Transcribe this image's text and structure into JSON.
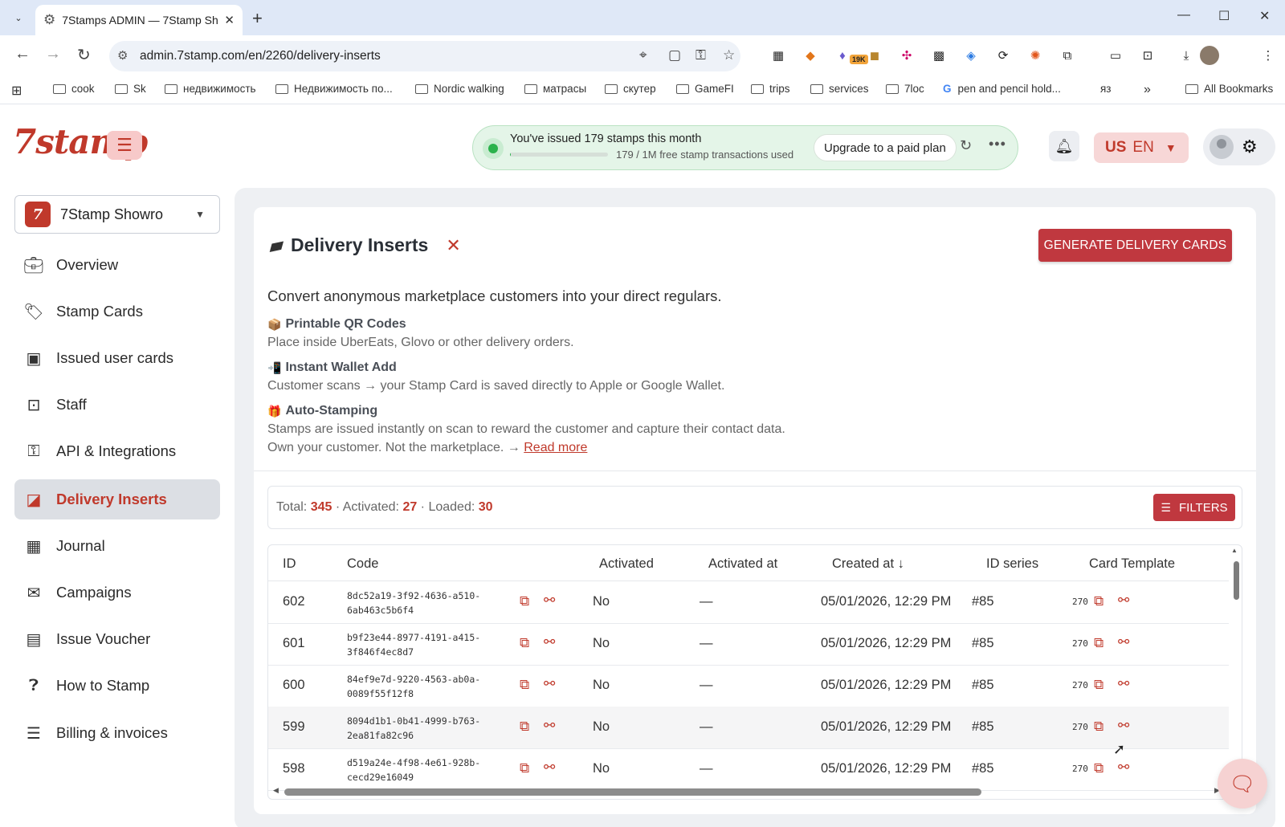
{
  "browser": {
    "tab_title": "7Stamps ADMIN — 7Stamp Sh",
    "url": "admin.7stamp.com/en/2260/delivery-inserts",
    "ext_badge": "19K",
    "bookmarks": [
      "cook",
      "Sk",
      "недвижимость",
      "Недвижимость по...",
      "Nordic walking",
      "матрасы",
      "скутер",
      "GameFI",
      "trips",
      "services",
      "7loc",
      "pen and pencil hold...",
      "яз"
    ],
    "all_bookmarks": "All Bookmarks"
  },
  "header": {
    "logo": "7stamp",
    "usage_title": "You've issued 179 stamps this month",
    "usage_sub": "179 / 1M free stamp transactions used",
    "usage_fraction": 0.000179,
    "upgrade_label": "Upgrade to a paid plan",
    "lang_flag": "US",
    "lang_code": "EN"
  },
  "sidebar": {
    "org_name": "7Stamp Showro",
    "items": [
      {
        "label": "Overview",
        "icon": "briefcase-icon"
      },
      {
        "label": "Stamp Cards",
        "icon": "tag-icon"
      },
      {
        "label": "Issued user cards",
        "icon": "id-card-icon"
      },
      {
        "label": "Staff",
        "icon": "badge-icon"
      },
      {
        "label": "API & Integrations",
        "icon": "key-icon"
      },
      {
        "label": "Delivery Inserts",
        "icon": "inserts-icon",
        "active": true
      },
      {
        "label": "Journal",
        "icon": "table-icon"
      },
      {
        "label": "Campaigns",
        "icon": "mail-icon"
      },
      {
        "label": "Issue Voucher",
        "icon": "voucher-icon"
      },
      {
        "label": "How to Stamp",
        "icon": "help-icon"
      },
      {
        "label": "Billing & invoices",
        "icon": "list-icon"
      }
    ]
  },
  "page": {
    "title": "Delivery Inserts",
    "generate_label": "GENERATE DELIVERY CARDS",
    "lead": "Convert anonymous marketplace customers into your direct regulars.",
    "features": [
      {
        "title": "Printable QR Codes",
        "text": "Place inside UberEats, Glovo or other delivery orders."
      },
      {
        "title": "Instant Wallet Add",
        "text": "Customer scans → your Stamp Card is saved directly to Apple or Google Wallet."
      },
      {
        "title": "Auto-Stamping",
        "text": "Stamps are issued instantly on scan to reward the customer and capture their contact data."
      }
    ],
    "closing_text": "Own your customer. Not the marketplace. → ",
    "read_more": "Read more",
    "stats": {
      "total_label": "Total: ",
      "total": "345",
      "activated_label": " · Activated: ",
      "activated": "27",
      "loaded_label": " · Loaded: ",
      "loaded": "30"
    },
    "filters_label": "FILTERS"
  },
  "table": {
    "columns": [
      "ID",
      "Code",
      "Activated",
      "Activated at",
      "Created at",
      "ID series",
      "Card Template"
    ],
    "sort_indicator": "↓",
    "rows": [
      {
        "id": "602",
        "code1": "8dc52a19-3f92-4636-a510-",
        "code2": "6ab463c5b6f4",
        "activated": "No",
        "activated_at": "—",
        "created_at": "05/01/2026, 12:29 PM",
        "series": "#85",
        "template": "270"
      },
      {
        "id": "601",
        "code1": "b9f23e44-8977-4191-a415-",
        "code2": "3f846f4ec8d7",
        "activated": "No",
        "activated_at": "—",
        "created_at": "05/01/2026, 12:29 PM",
        "series": "#85",
        "template": "270"
      },
      {
        "id": "600",
        "code1": "84ef9e7d-9220-4563-ab0a-",
        "code2": "0089f55f12f8",
        "activated": "No",
        "activated_at": "—",
        "created_at": "05/01/2026, 12:29 PM",
        "series": "#85",
        "template": "270"
      },
      {
        "id": "599",
        "code1": "8094d1b1-0b41-4999-b763-",
        "code2": "2ea81fa82c96",
        "activated": "No",
        "activated_at": "—",
        "created_at": "05/01/2026, 12:29 PM",
        "series": "#85",
        "template": "270"
      },
      {
        "id": "598",
        "code1": "d519a24e-4f98-4e61-928b-",
        "code2": "cecd29e16049",
        "activated": "No",
        "activated_at": "—",
        "created_at": "05/01/2026, 12:29 PM",
        "series": "#85",
        "template": "270"
      }
    ]
  },
  "colors": {
    "brand": "#c0392b",
    "success": "#2bb24c"
  }
}
